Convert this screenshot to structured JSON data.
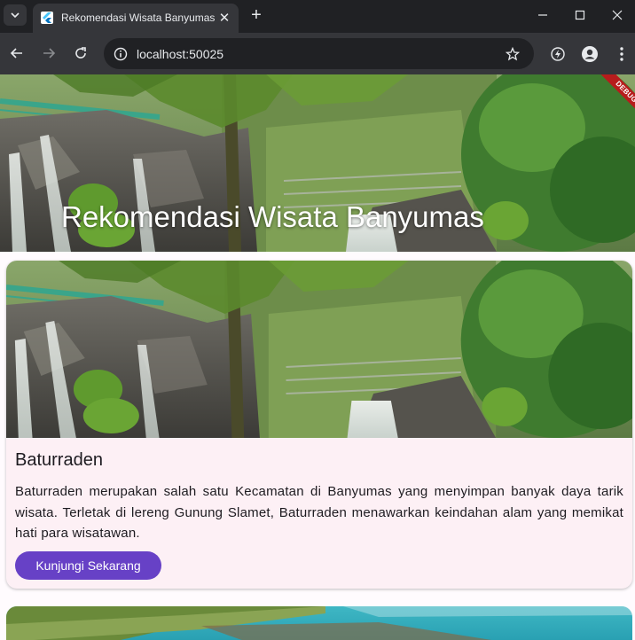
{
  "browser": {
    "tab_title": "Rekomendasi Wisata Banyumas",
    "url": "localhost:50025",
    "new_tab_symbol": "+",
    "close_symbol": "✕"
  },
  "icons": {
    "tab_list": "chevron-down-icon",
    "favicon": "flutter-icon",
    "minimize": "minimize-icon",
    "maximize": "maximize-icon",
    "close": "close-icon",
    "back": "back-arrow-icon",
    "forward": "forward-arrow-icon",
    "reload": "reload-icon",
    "site_info": "site-info-icon",
    "bookmark": "star-icon",
    "extension": "performance-icon",
    "profile": "profile-icon",
    "menu": "more-vert-icon"
  },
  "page": {
    "header_title": "Rekomendasi Wisata Banyumas",
    "debug_label": "DEBUG",
    "cards": [
      {
        "title": "Baturraden",
        "description": "Baturraden merupakan salah satu Kecamatan di Banyumas yang menyimpan banyak daya tarik wisata. Terletak di lereng Gunung Slamet, Baturraden menawarkan keindahan alam yang memikat hati para wisatawan.",
        "button_label": "Kunjungi Sekarang"
      }
    ]
  },
  "colors": {
    "browser_dark": "#202124",
    "browser_toolbar": "#35363a",
    "card_background": "#fdf0f5",
    "button_primary": "#6741c6",
    "debug_banner": "#b71c1c"
  }
}
